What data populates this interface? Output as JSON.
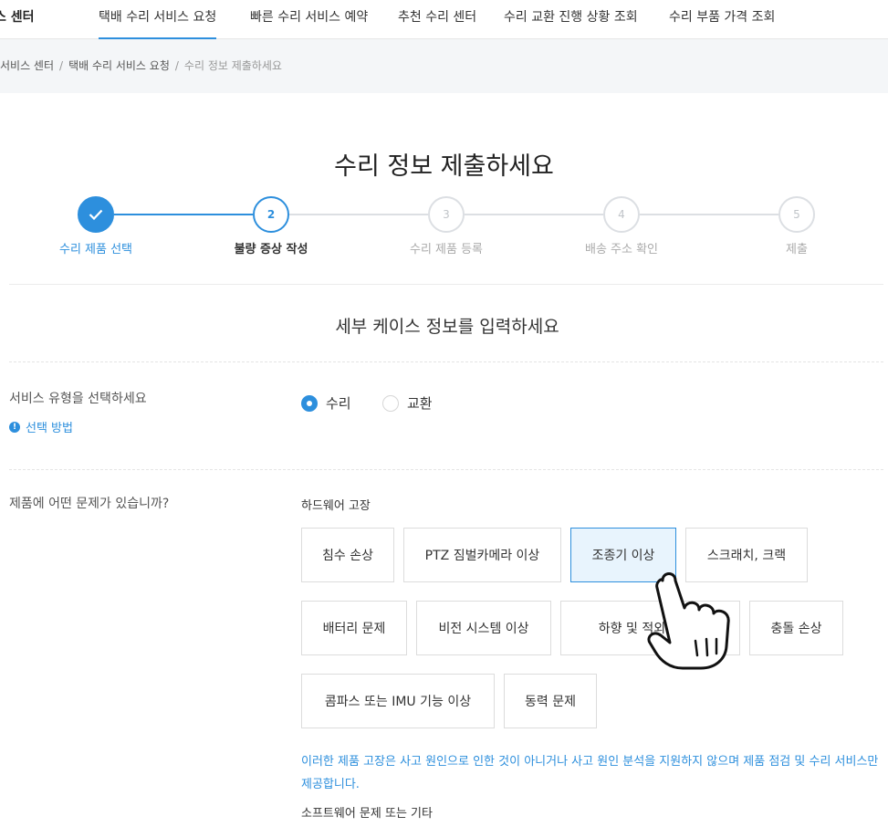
{
  "nav": {
    "brand": "스 센터",
    "items": [
      "택배 수리 서비스 요청",
      "빠른 수리 서비스 예약",
      "추천 수리 센터",
      "수리 교환 진행 상황 조회",
      "수리 부품 가격 조회"
    ]
  },
  "breadcrumb": {
    "items": [
      "서비스 센터",
      "택배 수리 서비스 요청"
    ],
    "current": "수리 정보 제출하세요",
    "separator": "/"
  },
  "page_title": "수리 정보 제출하세요",
  "steps": [
    {
      "number": "",
      "label": "수리 제품 선택",
      "state": "done"
    },
    {
      "number": "2",
      "label": "불량 증상 작성",
      "state": "current"
    },
    {
      "number": "3",
      "label": "수리 제품 등록",
      "state": "todo"
    },
    {
      "number": "4",
      "label": "배송 주소 확인",
      "state": "todo"
    },
    {
      "number": "5",
      "label": "제출",
      "state": "todo"
    }
  ],
  "section_title": "세부 케이스 정보를 입력하세요",
  "service_type": {
    "label": "서비스 유형을 선택하세요",
    "guide_link": "선택 방법",
    "options": [
      {
        "label": "수리",
        "checked": true
      },
      {
        "label": "교환",
        "checked": false
      }
    ]
  },
  "problem": {
    "label": "제품에 어떤 문제가 있습니까?",
    "hardware_group": "하드웨어 고장",
    "options": [
      "침수 손상",
      "PTZ 짐벌카메라 이상",
      "조종기 이상",
      "스크래치, 크랙",
      "배터리 문제",
      "비전 시스템 이상",
      "하향 및 적외선 ToF",
      "충돌 손상",
      "콤파스 또는 IMU 기능 이상",
      "동력 문제"
    ],
    "selected": "조종기 이상",
    "note": "이러한 제품 고장은 사고 원인으로 인한 것이 아니거나 사고 원인 분석을 지원하지 않으며 제품 점검 및 수리 서비스만 제공합니다.",
    "software_group": "소프트웨어 문제 또는 기타"
  },
  "colors": {
    "accent": "#2d8fdd",
    "selected_bg": "#e8f4fd",
    "border": "#dcdcdc",
    "crumb_bg": "#f4f6f8"
  },
  "icons": {
    "check": "check-icon",
    "info": "info-icon",
    "pointer": "hand-pointer-icon"
  }
}
